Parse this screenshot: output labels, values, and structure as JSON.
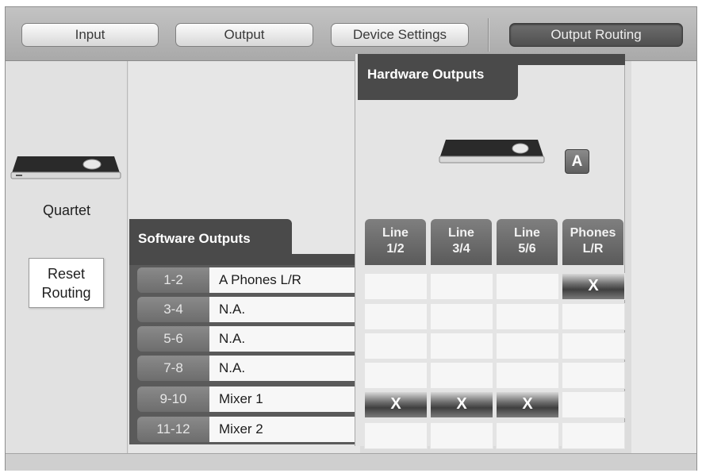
{
  "toolbar": {
    "tabs": [
      {
        "label": "Input"
      },
      {
        "label": "Output"
      },
      {
        "label": "Device Settings"
      },
      {
        "label": "Output Routing"
      }
    ]
  },
  "left": {
    "device_name": "Quartet",
    "reset_label": "Reset\nRouting"
  },
  "software_outputs": {
    "title": "Software Outputs",
    "rows": [
      {
        "channel": "1-2",
        "name": "A Phones L/R"
      },
      {
        "channel": "3-4",
        "name": "N.A."
      },
      {
        "channel": "5-6",
        "name": "N.A."
      },
      {
        "channel": "7-8",
        "name": "N.A."
      },
      {
        "channel": "9-10",
        "name": "Mixer 1"
      },
      {
        "channel": "11-12",
        "name": "Mixer 2"
      }
    ]
  },
  "hardware_outputs": {
    "title": "Hardware Outputs",
    "badge": "A",
    "columns": [
      {
        "line1": "Line",
        "line2": "1/2"
      },
      {
        "line1": "Line",
        "line2": "3/4"
      },
      {
        "line1": "Line",
        "line2": "5/6"
      },
      {
        "line1": "Phones",
        "line2": "L/R"
      }
    ]
  },
  "routing": {
    "mark": "X",
    "active": [
      [
        0,
        3
      ],
      [
        4,
        0
      ],
      [
        4,
        1
      ],
      [
        4,
        2
      ]
    ]
  }
}
